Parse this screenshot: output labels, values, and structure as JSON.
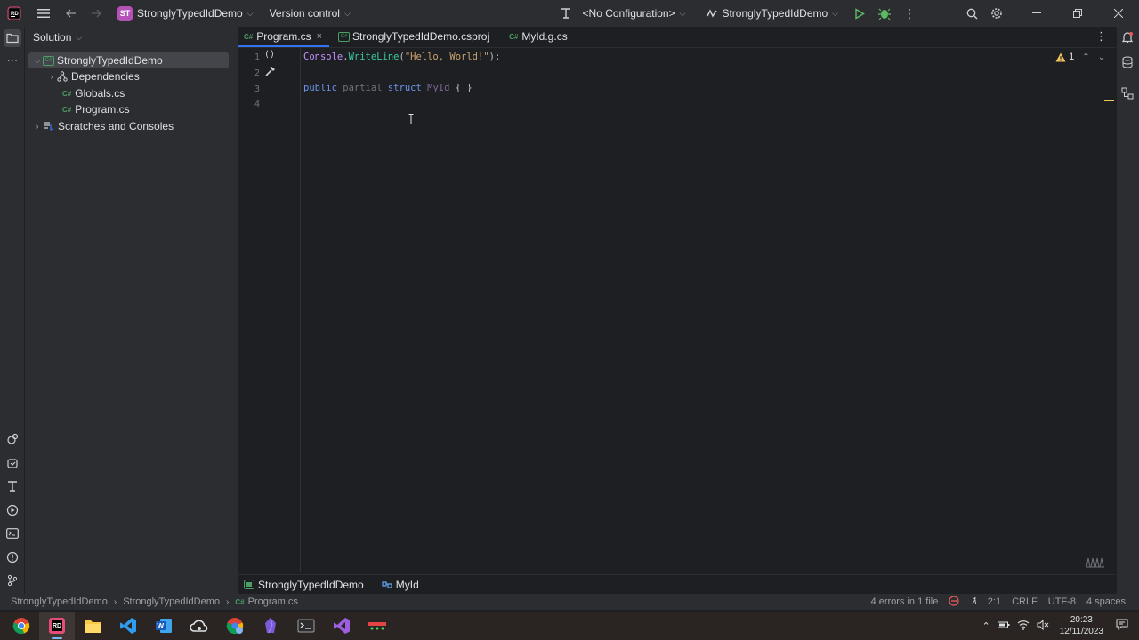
{
  "titlebar": {
    "project_badge": "ST",
    "project_name": "StronglyTypedIdDemo",
    "version_control": "Version control",
    "configuration": "<No Configuration>",
    "run_target": "StronglyTypedIdDemo"
  },
  "solution_panel": {
    "title": "Solution",
    "tree": [
      {
        "label": "StronglyTypedIdDemo",
        "badge": "C#",
        "expanded": true,
        "selected": true
      },
      {
        "label": "Dependencies",
        "badge": "",
        "expanded": false
      },
      {
        "label": "Globals.cs",
        "badge": "C#"
      },
      {
        "label": "Program.cs",
        "badge": "C#"
      },
      {
        "label": "Scratches and Consoles",
        "badge": "",
        "expanded": false
      }
    ]
  },
  "tabs": [
    {
      "label": "Program.cs",
      "badge": "C#",
      "active": true
    },
    {
      "label": "StronglyTypedIdDemo.csproj",
      "badge": ""
    },
    {
      "label": "MyId.g.cs",
      "badge": "C#"
    }
  ],
  "editor": {
    "line_numbers": [
      "1",
      "2",
      "3",
      "4"
    ],
    "line1": {
      "cls": "Console",
      "dot": ".",
      "meth": "WriteLine",
      "open": "(",
      "str": "\"Hello, World!\"",
      "close": ");"
    },
    "line3": {
      "kw1": "public",
      "kw2": "partial",
      "kw3": "struct",
      "type": "MyId",
      "body": "{ }"
    },
    "warning_count": "1"
  },
  "breadcrumb": {
    "project": "StronglyTypedIdDemo",
    "type": "MyId"
  },
  "statusbar": {
    "path": [
      "StronglyTypedIdDemo",
      "StronglyTypedIdDemo",
      "Program.cs"
    ],
    "path_badge": "C#",
    "errors": "4 errors in 1 file",
    "position": "2:1",
    "line_ending": "CRLF",
    "encoding": "UTF-8",
    "indent": "4 spaces"
  },
  "taskbar": {
    "time": "20:23",
    "date": "12/11/2023"
  },
  "colors": {
    "accent": "#3574f0",
    "warning": "#f2c55c",
    "error": "#e55c5c",
    "csharp_badge": "#4c9e64"
  }
}
